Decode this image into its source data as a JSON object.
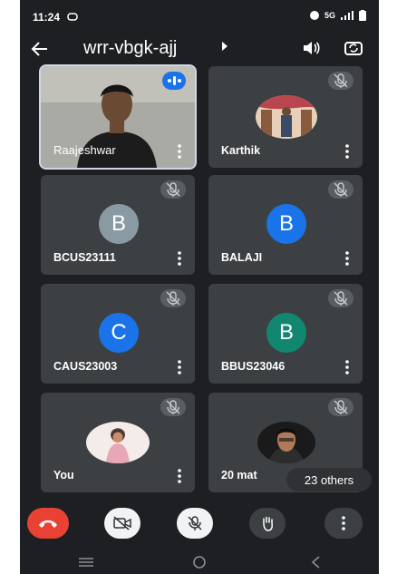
{
  "status_bar": {
    "time": "11:24",
    "network": "5G"
  },
  "app_bar": {
    "meeting_code": "wrr-vbgk-ajj"
  },
  "participants": [
    {
      "name": "Raajeshwar",
      "type": "video",
      "speaking": true
    },
    {
      "name": "Karthik",
      "type": "photo",
      "muted": true
    },
    {
      "name": "BCUS23111",
      "type": "initial",
      "initial": "B",
      "color": "#8a9aa3",
      "muted": true
    },
    {
      "name": "BALAJI",
      "type": "initial",
      "initial": "B",
      "color": "#1a73e8",
      "muted": true
    },
    {
      "name": "CAUS23003",
      "type": "initial",
      "initial": "C",
      "color": "#1a73e8",
      "muted": true
    },
    {
      "name": "BBUS23046",
      "type": "initial",
      "initial": "B",
      "color": "#12876f",
      "muted": true
    },
    {
      "name": "You",
      "type": "photo",
      "muted": true
    },
    {
      "name": "20 mat",
      "type": "photo",
      "muted": true
    }
  ],
  "others_pill": "23 others",
  "controls": {
    "end_call_color": "#e94235",
    "icons": [
      "end-call-icon",
      "camera-off-icon",
      "mic-off-icon",
      "raise-hand-icon",
      "more-icon"
    ]
  }
}
